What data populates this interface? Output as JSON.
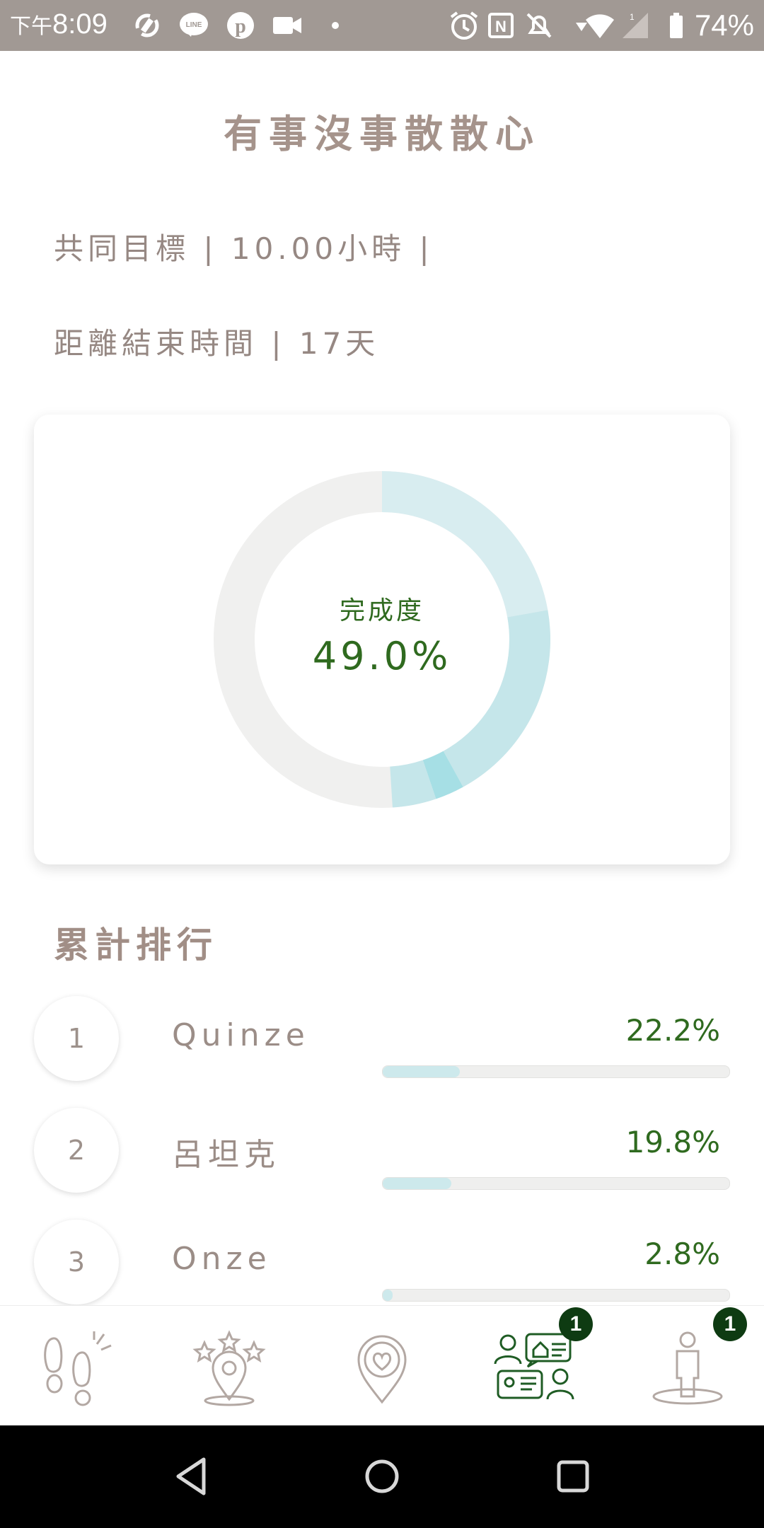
{
  "status_bar": {
    "ampm": "下午",
    "time": "8:09",
    "battery": "74%",
    "icons": [
      "sync-icon",
      "line-icon",
      "pinterest-icon",
      "video-icon",
      "dot-icon",
      "alarm-icon",
      "nfc-icon",
      "mute-icon",
      "data-arrow-icon",
      "wifi-icon",
      "signal-icon",
      "battery-icon"
    ]
  },
  "header": {
    "title": "有事沒事散散心"
  },
  "info": {
    "goal": "共同目標 | 10.00小時 |",
    "remaining": "距離結束時間 | 17天"
  },
  "progress_card": {
    "label": "完成度",
    "value": "49.0%",
    "fraction": 0.49,
    "colors": {
      "track": "#f0f0ef",
      "seg1": "#d8edf0",
      "seg2": "#c5e6ea",
      "seg3": "#a6dfe5"
    }
  },
  "ranking": {
    "title": "累計排行",
    "rows": [
      {
        "rank": "1",
        "name": "Quinze",
        "percent": "22.2%",
        "value": 0.222
      },
      {
        "rank": "2",
        "name": "呂坦克",
        "percent": "19.8%",
        "value": 0.198
      },
      {
        "rank": "3",
        "name": "Onze",
        "percent": "2.8%",
        "value": 0.028
      }
    ]
  },
  "bottom_nav": {
    "items": [
      {
        "icon": "footprints-icon"
      },
      {
        "icon": "star-location-icon"
      },
      {
        "icon": "heart-location-icon"
      },
      {
        "icon": "community-icon",
        "badge": "1",
        "active": true
      },
      {
        "icon": "person-icon",
        "badge": "1"
      }
    ]
  },
  "colors": {
    "accent": "#2f6a1f",
    "status_bar": "#a19994",
    "badge": "#0e3b12"
  }
}
